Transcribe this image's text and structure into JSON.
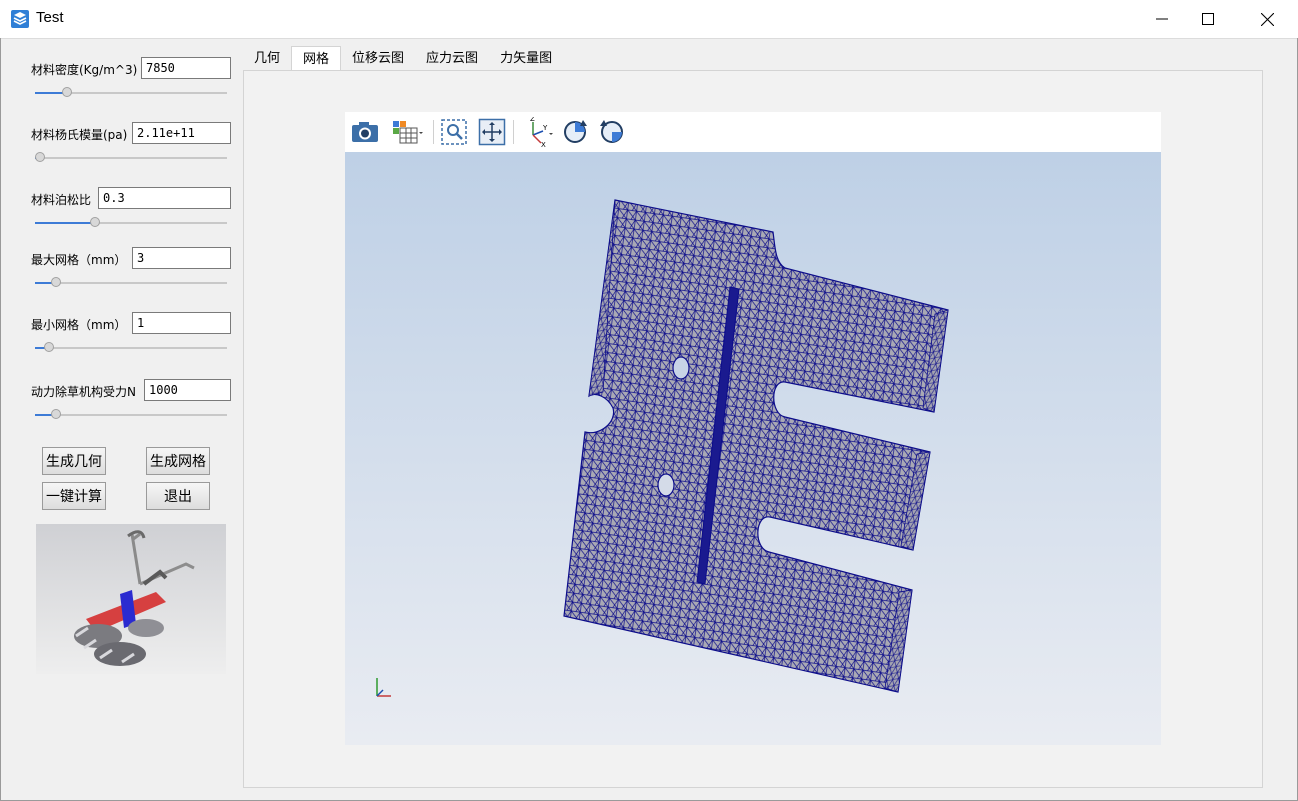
{
  "window": {
    "title": "Test"
  },
  "params": [
    {
      "label": "材料密度(Kg/m^3)",
      "value": "7850",
      "slider_fraction": 0.15
    },
    {
      "label": "材料杨氏模量(pa)",
      "value": "2.11e+11",
      "slider_fraction": 0.0
    },
    {
      "label": "材料泊松比",
      "value": "0.3",
      "slider_fraction": 0.3
    },
    {
      "label": "最大网格（mm）",
      "value": "3",
      "slider_fraction": 0.09
    },
    {
      "label": "最小网格（mm）",
      "value": "1",
      "slider_fraction": 0.05
    },
    {
      "label": "动力除草机构受力N",
      "value": "1000",
      "slider_fraction": 0.09
    }
  ],
  "buttons": {
    "gen_geometry": "生成几何",
    "gen_mesh": "生成网格",
    "one_click": "一键计算",
    "exit": "退出"
  },
  "tabs": [
    "几何",
    "网格",
    "位移云图",
    "应力云图",
    "力矢量图"
  ],
  "active_tab": "网格",
  "viewer": {
    "toolbar": [
      "camera-icon",
      "display-mode-icon",
      "zoom-window-icon",
      "fit-all-icon",
      "axis-view-icon",
      "rotate-cw-icon",
      "rotate-ccw-icon"
    ],
    "triad": {
      "z": "Z",
      "y": "Y",
      "x": "X"
    },
    "mesh_color": "#0c0c8a",
    "mesh_fill": "#a9a9b4"
  }
}
